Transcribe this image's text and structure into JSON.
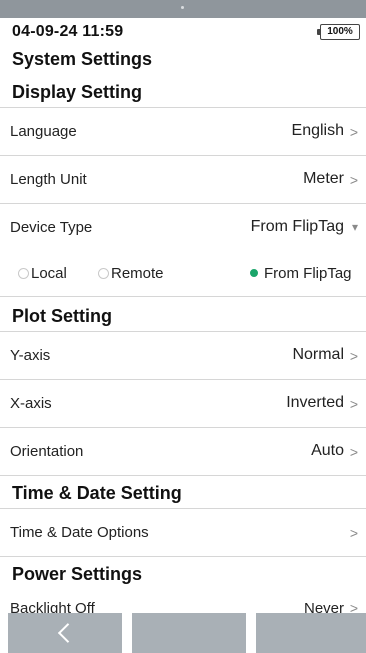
{
  "status": {
    "datetime": "04-09-24 11:59",
    "battery": "100%"
  },
  "page_title": "System Settings",
  "sections": {
    "display": {
      "title": "Display Setting",
      "language": {
        "label": "Language",
        "value": "English"
      },
      "length_unit": {
        "label": "Length Unit",
        "value": "Meter"
      },
      "device_type": {
        "label": "Device Type",
        "value": "From FlipTag"
      },
      "device_options": [
        {
          "label": "Local",
          "selected": false
        },
        {
          "label": "Remote",
          "selected": false
        },
        {
          "label": "From FlipTag",
          "selected": true
        }
      ]
    },
    "plot": {
      "title": "Plot Setting",
      "y_axis": {
        "label": "Y-axis",
        "value": "Normal"
      },
      "x_axis": {
        "label": "X-axis",
        "value": "Inverted"
      },
      "orientation": {
        "label": "Orientation",
        "value": "Auto"
      }
    },
    "time_date": {
      "title": "Time & Date Setting",
      "options": {
        "label": "Time & Date Options",
        "value": ""
      }
    },
    "power": {
      "title": "Power Settings",
      "backlight": {
        "label": "Backlight Off",
        "value": "Never"
      }
    }
  },
  "icons": {
    "chevron": "chevron-right-icon",
    "caret": "caret-down-icon",
    "back": "back-arrow-icon"
  },
  "colors": {
    "selected_radio": "#1aa56a",
    "bottom_buttons": "#a9b0b6"
  }
}
